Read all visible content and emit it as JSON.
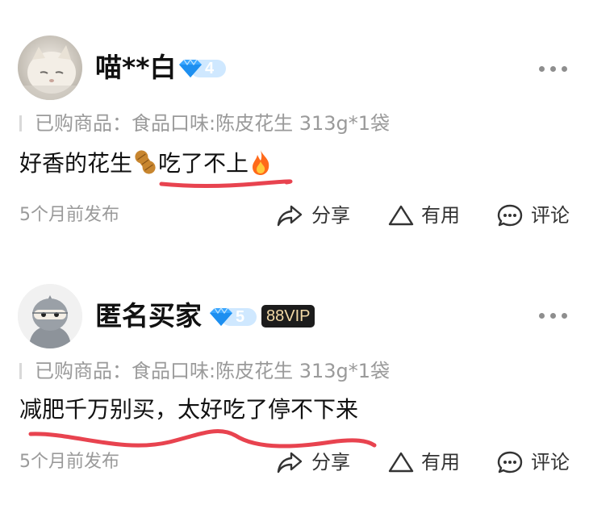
{
  "reviews": [
    {
      "username": "喵**白",
      "level": "4",
      "vip_badge": "",
      "purchase_label": "已购商品：",
      "purchase_item": "食品口味:陈皮花生 313g*1袋",
      "text_part1": "好香的花生",
      "text_part2": "吃了不上",
      "time": "5个月前发布",
      "share_label": "分享",
      "useful_label": "有用",
      "comment_label": "评论",
      "icons": [
        "peanut-emoji",
        "fire-emoji"
      ]
    },
    {
      "username": "匿名买家",
      "level": "5",
      "vip_badge": "88VIP",
      "purchase_label": "已购商品：",
      "purchase_item": "食品口味:陈皮花生 313g*1袋",
      "text": "减肥千万别买，太好吃了停不下来",
      "time": "5个月前发布",
      "share_label": "分享",
      "useful_label": "有用",
      "comment_label": "评论"
    }
  ],
  "colors": {
    "annotation_red": "#e8434f",
    "diamond_blue": "#3aa6ff",
    "muted_text": "#9a9a9a",
    "vip_bg": "#1c1c1c",
    "vip_text": "#f2d9a6"
  }
}
